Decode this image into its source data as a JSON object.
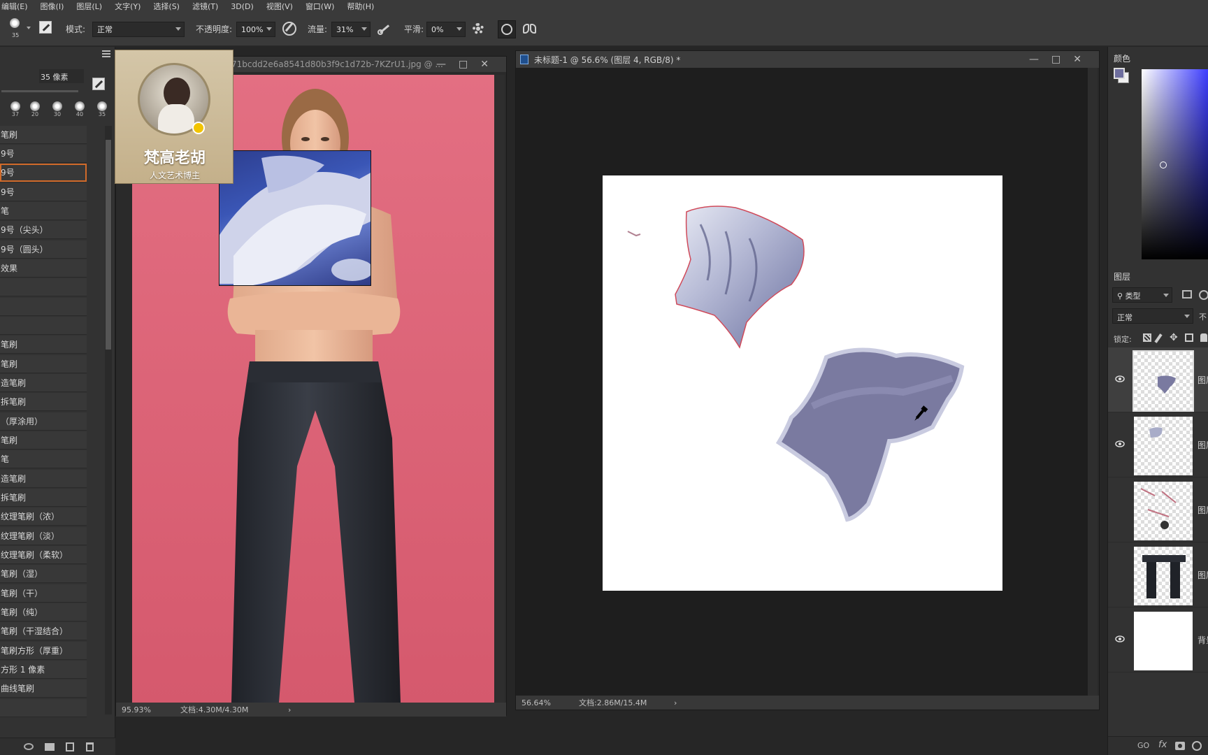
{
  "menu": [
    "编辑(E)",
    "图像(I)",
    "图层(L)",
    "文字(Y)",
    "选择(S)",
    "滤镜(T)",
    "3D(D)",
    "视图(V)",
    "窗口(W)",
    "帮助(H)"
  ],
  "options": {
    "brush_size": "35",
    "mode_label": "模式:",
    "mode_value": "正常",
    "opacity_label": "不透明度:",
    "opacity_value": "100%",
    "flow_label": "流量:",
    "flow_value": "31%",
    "smooth_label": "平滑:",
    "smooth_value": "0%"
  },
  "brush_panel": {
    "size_value": "35 像素",
    "presets": [
      "37",
      "20",
      "30",
      "40",
      "35"
    ],
    "items": [
      "笔刷",
      "9号",
      "9号",
      "9号",
      "笔",
      "9号（尖头）",
      "9号（圆头）",
      "效果",
      "",
      "",
      "",
      "笔刷",
      "笔刷",
      "造笔刷",
      "拆笔刷",
      "（厚涂用）",
      "笔刷",
      "笔",
      "造笔刷",
      "拆笔刷",
      "纹理笔刷（浓）",
      "纹理笔刷（淡）",
      "纹理笔刷（柔软）",
      "笔刷（湿）",
      "笔刷（干）",
      "笔刷（纯）",
      "笔刷（干湿结合）",
      "笔刷方形（厚重）",
      "方形 1 像素",
      "曲线笔刷",
      "",
      ""
    ],
    "selected_index": 2
  },
  "overlay": {
    "name": "梵高老胡",
    "subtitle": "人文艺术博主"
  },
  "doc1": {
    "title": "71bcdd2e6a8541d80b3f9c1d72b-7KZrU1.jpg @ ...",
    "zoom": "95.93%",
    "file_info": "文档:4.30M/4.30M"
  },
  "doc2": {
    "title": "未标题-1 @ 56.6% (图层 4, RGB/8) *",
    "zoom": "56.64%",
    "file_info": "文档:2.86M/15.4M"
  },
  "color_panel": {
    "tab": "颜色",
    "foreground": "#6e6e9e",
    "background": "#f0f0f0",
    "hue": "#3b3bff"
  },
  "layers_panel": {
    "tab": "图层",
    "filter_kind": "类型",
    "blend_mode": "正常",
    "opacity_label_partial": "不",
    "lock_label": "锁定:",
    "layers": [
      {
        "name": "图层",
        "visible": true,
        "selected": true
      },
      {
        "name": "图层",
        "visible": true,
        "selected": false
      },
      {
        "name": "图层",
        "visible": false,
        "selected": false
      },
      {
        "name": "图层",
        "visible": false,
        "selected": false
      },
      {
        "name": "背景",
        "visible": true,
        "selected": false
      }
    ]
  }
}
